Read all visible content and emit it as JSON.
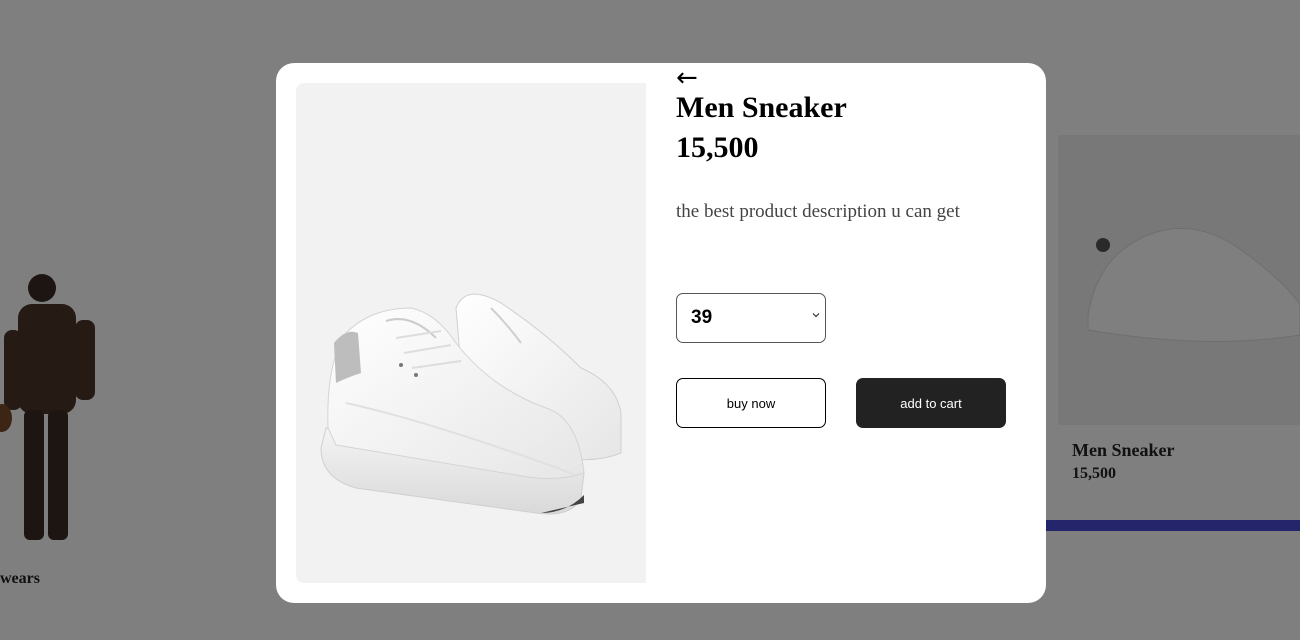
{
  "background": {
    "left_card": {
      "title": "wears"
    },
    "right_card": {
      "title": "Men Sneaker",
      "price": "15,500"
    },
    "overlay_color": "#000000",
    "accent_color": "#4b4bd8"
  },
  "modal": {
    "back_icon": "arrow-left-icon",
    "back_glyph": "←",
    "title": "Men Sneaker",
    "price": "15,500",
    "description": "the best product description u can get",
    "size": {
      "selected": "39"
    },
    "buttons": {
      "buy_now": "buy now",
      "add_to_cart": "add to cart"
    },
    "colors": {
      "cart_button": "#222222",
      "image_bg": "#f2f2f2"
    }
  }
}
